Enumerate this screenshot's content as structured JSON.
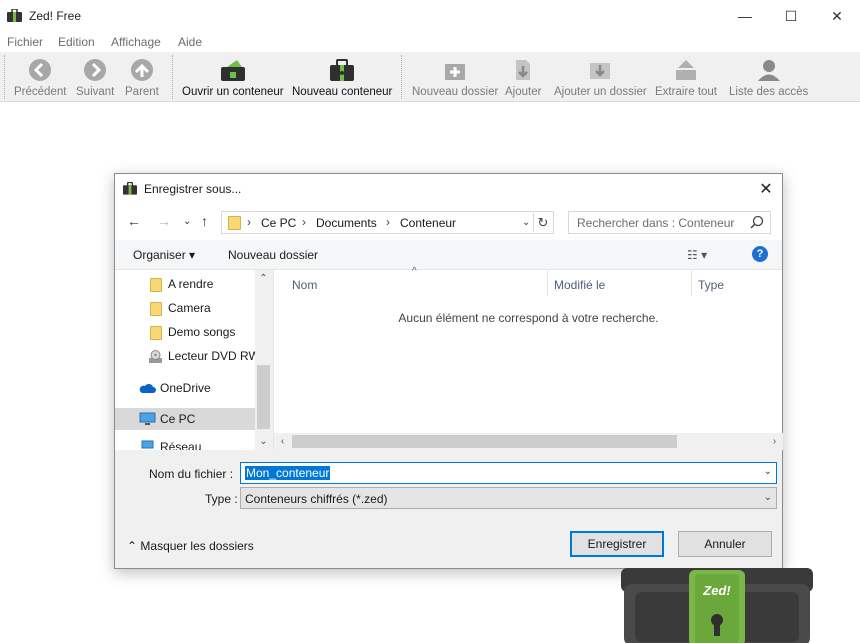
{
  "app": {
    "title": "Zed! Free",
    "window_controls": {
      "minimize": "—",
      "maximize": "☐",
      "close": "✕"
    }
  },
  "menu": [
    "Fichier",
    "Edition",
    "Affichage",
    "Aide"
  ],
  "toolbar": {
    "back": "Précédent",
    "forward": "Suivant",
    "parent": "Parent",
    "open_container": "Ouvrir un conteneur",
    "new_container": "Nouveau conteneur",
    "new_folder": "Nouveau dossier",
    "add": "Ajouter",
    "add_folder": "Ajouter un dossier",
    "extract_all": "Extraire tout",
    "access_list": "Liste des accès"
  },
  "dialog": {
    "title": "Enregistrer sous...",
    "breadcrumb": [
      "Ce PC",
      "Documents",
      "Conteneur"
    ],
    "search_placeholder": "Rechercher dans : Conteneur",
    "organize": "Organiser",
    "new_folder": "Nouveau dossier",
    "tree": [
      {
        "label": "A rendre",
        "icon": "folder-icon"
      },
      {
        "label": "Camera",
        "icon": "folder-icon"
      },
      {
        "label": "Demo songs",
        "icon": "folder-icon"
      },
      {
        "label": "Lecteur DVD RW",
        "icon": "dvd-drive-icon"
      },
      {
        "label": "OneDrive",
        "icon": "cloud-icon"
      },
      {
        "label": "Ce PC",
        "icon": "computer-icon"
      },
      {
        "label": "Réseau",
        "icon": "network-icon"
      }
    ],
    "columns": {
      "name": "Nom",
      "modified": "Modifié le",
      "type": "Type"
    },
    "empty_message": "Aucun élément ne correspond à votre recherche.",
    "filename_label": "Nom du fichier :",
    "filename_value": "Mon_conteneur",
    "filetype_label": "Type :",
    "filetype_value": "Conteneurs chiffrés (*.zed)",
    "hide_folders": "Masquer les dossiers",
    "save_button": "Enregistrer",
    "cancel_button": "Annuler"
  },
  "logo_text": "Zed!",
  "colors": {
    "accent": "#0078d7",
    "zed_green": "#7ab648",
    "zed_dark": "#3a3a3a"
  }
}
